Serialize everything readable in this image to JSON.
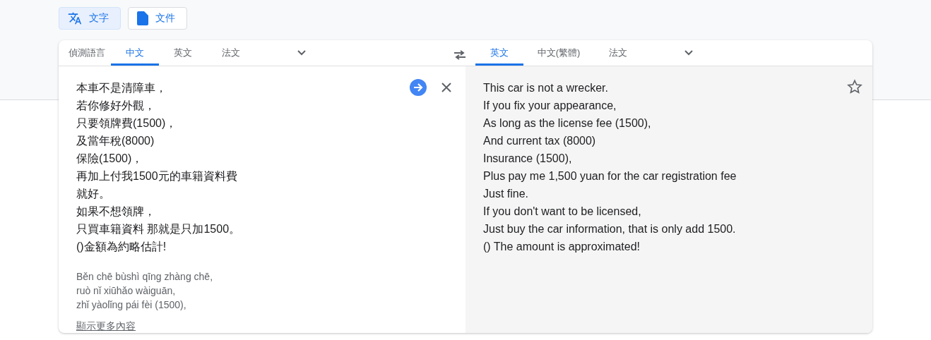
{
  "mode_buttons": [
    {
      "label": "文字",
      "kind": "translate",
      "selected": true
    },
    {
      "label": "文件",
      "kind": "document",
      "selected": false
    }
  ],
  "source": {
    "languages": [
      {
        "label": "偵測語言",
        "selected": false
      },
      {
        "label": "中文",
        "selected": true
      },
      {
        "label": "英文",
        "selected": false
      },
      {
        "label": "法文",
        "selected": false
      }
    ],
    "lines": [
      "本車不是清障車，",
      "若你修好外觀，",
      "只要領牌費(1500)，",
      "及當年稅(8000)",
      "保險(1500)，",
      "再加上付我1500元的車籍資料費",
      "就好。",
      "如果不想領牌，",
      "只買車籍資料 那就是只加1500。",
      "()金額為約略估計!"
    ],
    "romanization": [
      "Běn chē bùshì qīng zhàng chē,",
      "ruò nǐ xiūhǎo wàiguān,",
      "zhǐ yàolǐng pái fèi (1500),"
    ],
    "show_more": "顯示更多內容"
  },
  "target": {
    "languages": [
      {
        "label": "英文",
        "selected": true
      },
      {
        "label": "中文(繁體)",
        "selected": false
      },
      {
        "label": "法文",
        "selected": false
      }
    ],
    "lines": [
      "This car is not a wrecker.",
      "If you fix your appearance,",
      "As long as the license fee (1500),",
      "And current tax (8000)",
      "Insurance (1500),",
      "Plus pay me 1,500 yuan for the car registration fee",
      "Just fine.",
      "If you don't want to be licensed,",
      "Just buy the car information, that is only add 1500.",
      "() The amount is approximated!"
    ]
  }
}
